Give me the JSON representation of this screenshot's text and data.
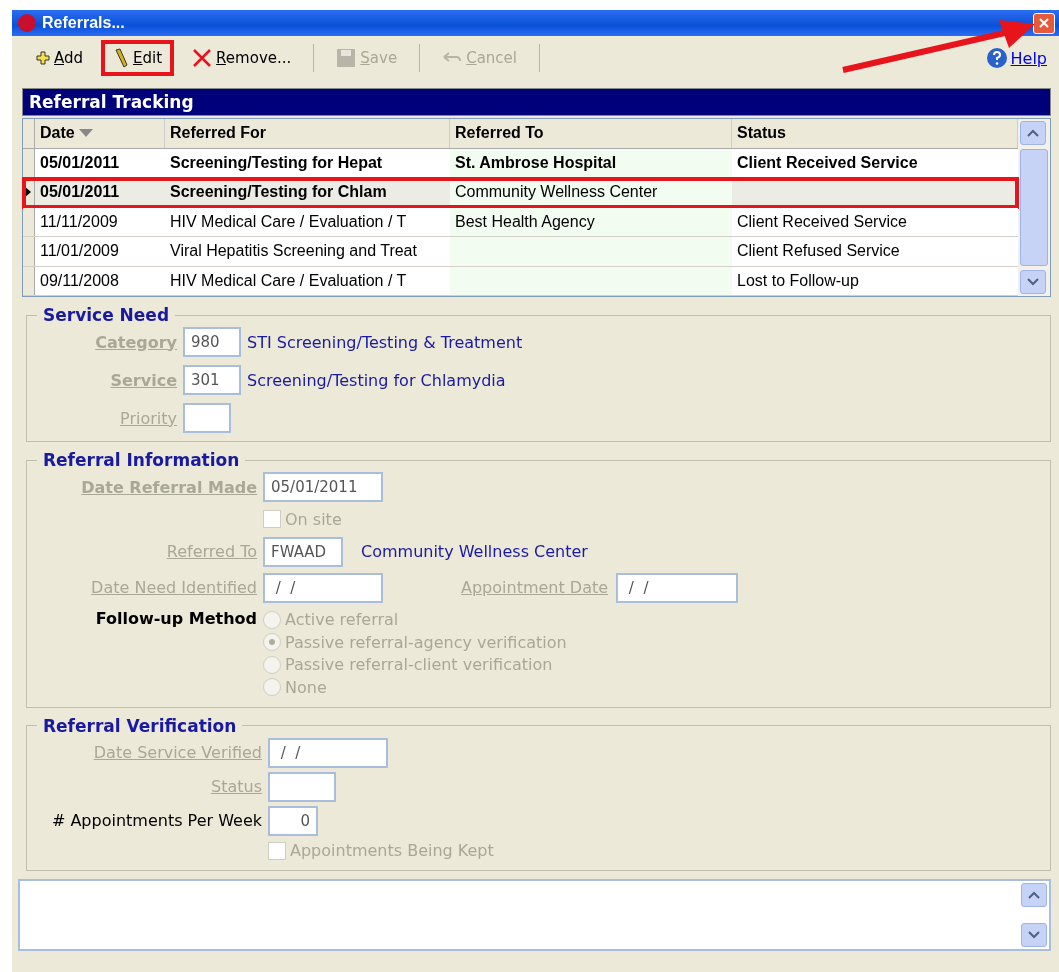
{
  "window": {
    "title": "Referrals..."
  },
  "toolbar": [
    {
      "kind": "add",
      "label": "Add",
      "disabled": false,
      "highlighted": false
    },
    {
      "kind": "edit",
      "label": "Edit",
      "disabled": false,
      "highlighted": true
    },
    {
      "kind": "remove",
      "label": "Remove...",
      "disabled": false,
      "highlighted": false
    },
    {
      "kind": "save",
      "label": "Save",
      "disabled": true,
      "highlighted": false
    },
    {
      "kind": "cancel",
      "label": "Cancel",
      "disabled": true,
      "highlighted": false
    }
  ],
  "help": "Help",
  "annotation_arrow": true,
  "tracking": {
    "title": "Referral Tracking",
    "columns": [
      "Date",
      "Referred For",
      "Referred To",
      "Status"
    ],
    "rows": [
      {
        "date": "05/01/2011",
        "referred_for": "Screening/Testing for Hepat",
        "referred_to": "St. Ambrose Hospital",
        "status": "Client Received Service",
        "bold": true,
        "selected": false,
        "highlighted": false
      },
      {
        "date": "05/01/2011",
        "referred_for": "Screening/Testing for Chlam",
        "referred_to": "Community Wellness Center",
        "status": "",
        "bold": true,
        "selected": true,
        "highlighted": true
      },
      {
        "date": "11/11/2009",
        "referred_for": "HIV Medical Care / Evaluation / T",
        "referred_to": "Best Health Agency",
        "status": "Client Received Service",
        "bold": false,
        "selected": false,
        "highlighted": false
      },
      {
        "date": "11/01/2009",
        "referred_for": "Viral Hepatitis Screening and Treat",
        "referred_to": "",
        "status": "Client Refused Service",
        "bold": false,
        "selected": false,
        "highlighted": false
      },
      {
        "date": "09/11/2008",
        "referred_for": "HIV Medical Care / Evaluation / T",
        "referred_to": "",
        "status": "Lost to Follow-up",
        "bold": false,
        "selected": false,
        "highlighted": false
      }
    ]
  },
  "service_need": {
    "title": "Service Need",
    "category": {
      "label": "Category",
      "code": "980",
      "description": "STI Screening/Testing & Treatment"
    },
    "service": {
      "label": "Service",
      "code": "301",
      "description": "Screening/Testing for Chlamydia"
    },
    "priority": {
      "label": "Priority"
    }
  },
  "referral_information": {
    "title": "Referral Information",
    "date_referral_made": {
      "label": "Date Referral Made",
      "value": "05/01/2011"
    },
    "on_site": {
      "label": "On site",
      "checked": false
    },
    "referred_to": {
      "label": "Referred To",
      "code": "FWAAD",
      "description": "Community Wellness Center"
    },
    "date_need_identified": {
      "label": "Date Need Identified",
      "value": " /  /"
    },
    "appointment_date": {
      "label": "Appointment Date",
      "value": " /  /"
    },
    "follow_up_method": {
      "label": "Follow-up Method",
      "options": [
        {
          "label": "Active referral",
          "selected": false
        },
        {
          "label": "Passive referral-agency verification",
          "selected": true
        },
        {
          "label": "Passive referral-client verification",
          "selected": false
        },
        {
          "label": "None",
          "selected": false
        }
      ]
    }
  },
  "referral_verification": {
    "title": "Referral Verification",
    "date_service_verified": {
      "label": "Date Service Verified",
      "value": " /  /"
    },
    "status": {
      "label": "Status"
    },
    "appointments_per_week": {
      "label": "# Appointments Per Week",
      "value": "0"
    },
    "appointments_being_kept": {
      "label": "Appointments Being Kept",
      "checked": false
    }
  }
}
